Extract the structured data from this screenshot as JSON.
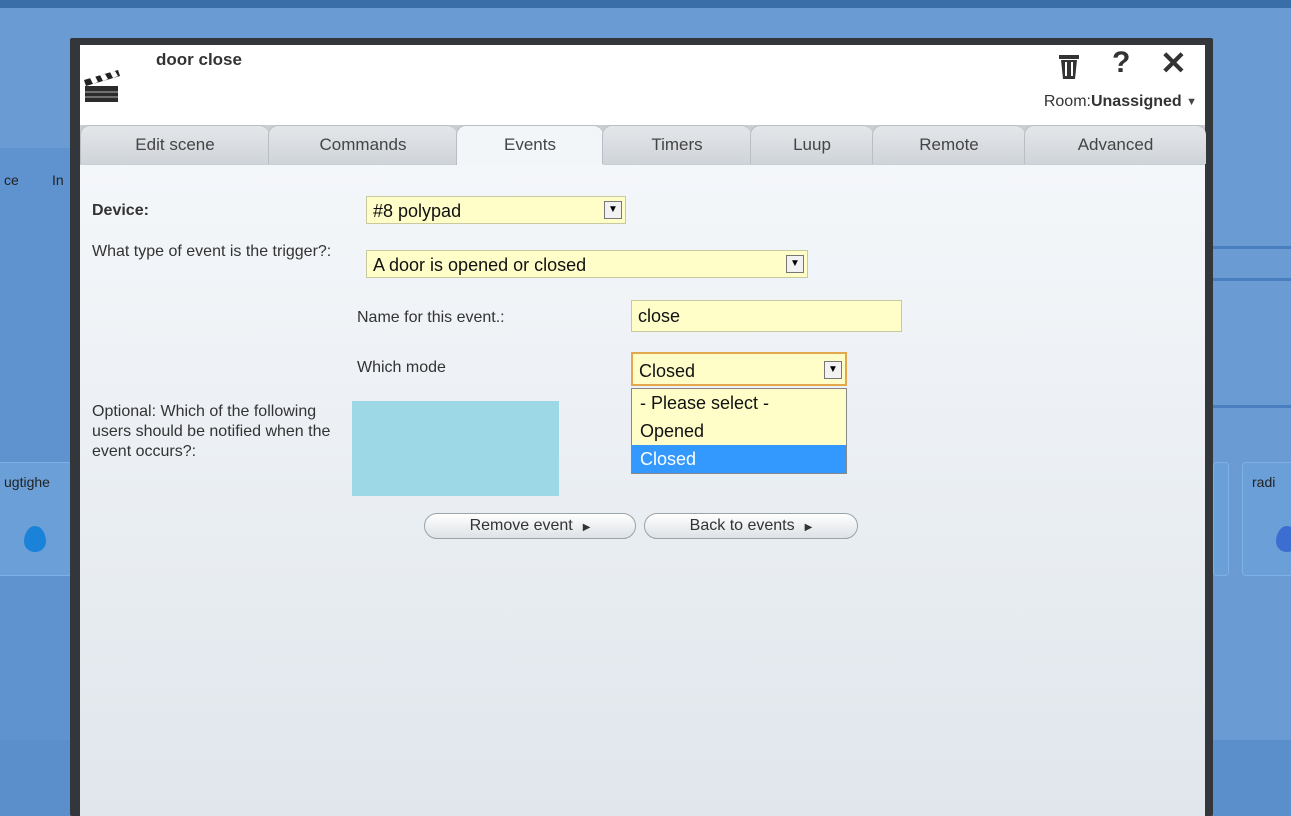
{
  "dialog": {
    "title": "door close",
    "room_label": "Room:",
    "room_value": "Unassigned",
    "delete_icon": "trash-icon",
    "help_icon": "?",
    "close_icon": "✕"
  },
  "tabs": [
    "Edit scene",
    "Commands",
    "Events",
    "Timers",
    "Luup",
    "Remote",
    "Advanced"
  ],
  "active_tab": "Events",
  "form": {
    "device_label": "Device:",
    "device_value": "#8 polypad",
    "event_type_label": "What type of event is the trigger?:",
    "event_type_value": "A door is opened or closed",
    "event_name_label": "Name for this event.:",
    "event_name_value": "close",
    "mode_label": "Which mode",
    "mode_value": "Closed",
    "mode_options": [
      "- Please select -",
      "Opened",
      "Closed"
    ],
    "notify_label": "Optional: Which of the following users should be notified when the event occurs?:",
    "remove_button": "Remove event",
    "back_button": "Back to events"
  },
  "background": {
    "left_text_1": "ce",
    "left_text_2": "In",
    "left_card_label": "ugtighe",
    "right_card_label": "radi"
  },
  "colors": {
    "background_blue": "#6a9bd3",
    "input_yellow": "#fffdc8",
    "selected_option": "#3399ff",
    "users_box": "#9dd8e6"
  }
}
